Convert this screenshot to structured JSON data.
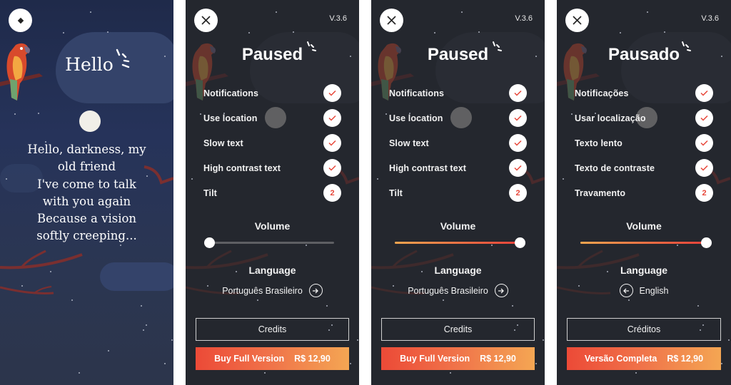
{
  "intro_screen": {
    "title": "Hello",
    "lyrics": [
      "Hello, darkness, my",
      "old friend",
      "I've come to talk",
      "with you again",
      "Because a vision",
      "softly creeping..."
    ],
    "menu_icon": "diamond-icon"
  },
  "settings_screens": [
    {
      "version": "V.3.6",
      "title": "Paused",
      "close_icon": "close-icon",
      "options": [
        {
          "label": "Notifications",
          "state": "checked"
        },
        {
          "label": "Use location",
          "state": "checked"
        },
        {
          "label": "Slow text",
          "state": "checked"
        },
        {
          "label": "High contrast text",
          "state": "checked"
        },
        {
          "label": "Tilt",
          "state": "2"
        }
      ],
      "volume_label": "Volume",
      "volume_value": 0,
      "language_label": "Language",
      "language_value": "Português Brasileiro",
      "language_arrow": "right",
      "credits_label": "Credits",
      "buy_label": "Buy Full Version",
      "buy_price": "R$ 12,90"
    },
    {
      "version": "V.3.6",
      "title": "Paused",
      "close_icon": "close-icon",
      "options": [
        {
          "label": "Notifications",
          "state": "checked"
        },
        {
          "label": "Use location",
          "state": "checked"
        },
        {
          "label": "Slow text",
          "state": "checked"
        },
        {
          "label": "High contrast text",
          "state": "checked"
        },
        {
          "label": "Tilt",
          "state": "2"
        }
      ],
      "volume_label": "Volume",
      "volume_value": 100,
      "language_label": "Language",
      "language_value": "Português Brasileiro",
      "language_arrow": "right",
      "credits_label": "Credits",
      "buy_label": "Buy Full Version",
      "buy_price": "R$ 12,90"
    },
    {
      "version": "V.3.6",
      "title": "Pausado",
      "close_icon": "close-icon",
      "options": [
        {
          "label": "Notificações",
          "state": "checked"
        },
        {
          "label": "Usar localização",
          "state": "checked"
        },
        {
          "label": "Texto lento",
          "state": "checked"
        },
        {
          "label": "Texto de contraste",
          "state": "checked"
        },
        {
          "label": "Travamento",
          "state": "2"
        }
      ],
      "volume_label": "Volume",
      "volume_value": 100,
      "language_label": "Language",
      "language_value": "English",
      "language_arrow": "left",
      "credits_label": "Créditos",
      "buy_label": "Versão Completa",
      "buy_price": "R$ 12,90"
    }
  ],
  "colors": {
    "accent_red": "#e8473a",
    "gradient_start": "#ec4a37",
    "gradient_end": "#f4a653",
    "panel_bg": "#24272e",
    "night_sky": "#26335a"
  }
}
